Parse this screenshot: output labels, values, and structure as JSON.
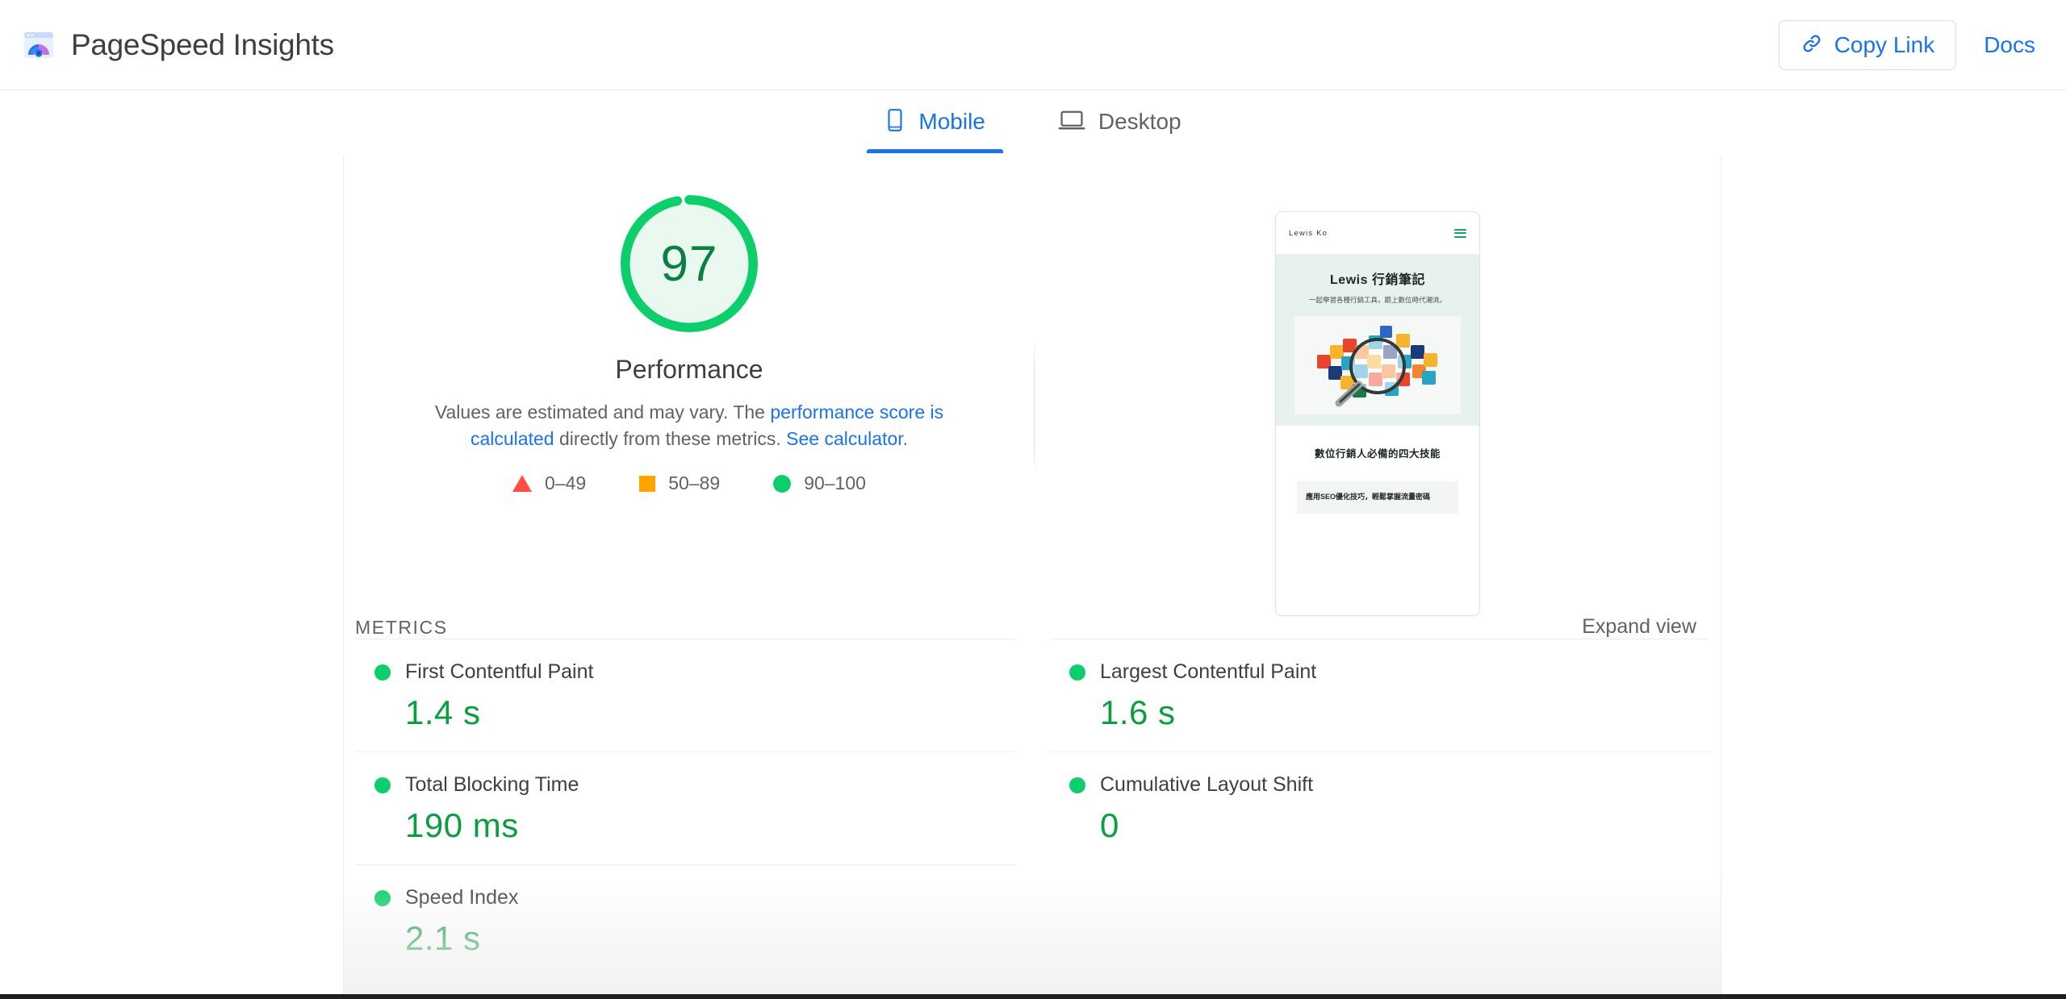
{
  "header": {
    "app_title": "PageSpeed Insights",
    "logo_icon": "pagespeed-logo-icon",
    "copy_link_label": "Copy Link",
    "copy_link_icon": "link-icon",
    "docs_label": "Docs"
  },
  "tabs": [
    {
      "label": "Mobile",
      "icon": "mobile-phone-icon",
      "active": true
    },
    {
      "label": "Desktop",
      "icon": "laptop-icon",
      "active": false
    }
  ],
  "summary": {
    "score": "97",
    "category": "Performance",
    "description_part1": "Values are estimated and may vary. The ",
    "description_link1": "performance score is calculated",
    "description_part2": " directly from these metrics. ",
    "description_link2": "See calculator.",
    "legend": [
      {
        "shape": "triangle",
        "range": "0–49",
        "color": "#ff4e42"
      },
      {
        "shape": "square",
        "range": "50–89",
        "color": "#ffa400"
      },
      {
        "shape": "circle",
        "range": "90–100",
        "color": "#0cce6b"
      }
    ]
  },
  "thumbnail": {
    "site_brand": "Lewis Ko",
    "menu_icon": "hamburger-menu-icon",
    "hero_title": "Lewis 行銷筆記",
    "hero_subtitle": "一起學習各種行銷工具，跟上數位時代潮流。",
    "hero_image": "puzzle-pieces-magnifier-image",
    "section_title": "數位行銷人必備的四大技能",
    "card_text": "應用SEO優化技巧，輕鬆掌握流量密碼"
  },
  "metrics_section": {
    "title": "METRICS",
    "expand_label": "Expand view",
    "items": [
      {
        "label": "First Contentful Paint",
        "value": "1.4 s",
        "status": "good"
      },
      {
        "label": "Largest Contentful Paint",
        "value": "1.6 s",
        "status": "good"
      },
      {
        "label": "Total Blocking Time",
        "value": "190 ms",
        "status": "good"
      },
      {
        "label": "Cumulative Layout Shift",
        "value": "0",
        "status": "good"
      },
      {
        "label": "Speed Index",
        "value": "2.1 s",
        "status": "good"
      }
    ]
  },
  "colors": {
    "accent_blue": "#1a73e8",
    "good_green": "#0cce6b",
    "value_green": "#0c9d3f",
    "score_green": "#0b8043",
    "average_orange": "#ffa400",
    "poor_red": "#ff4e42"
  }
}
